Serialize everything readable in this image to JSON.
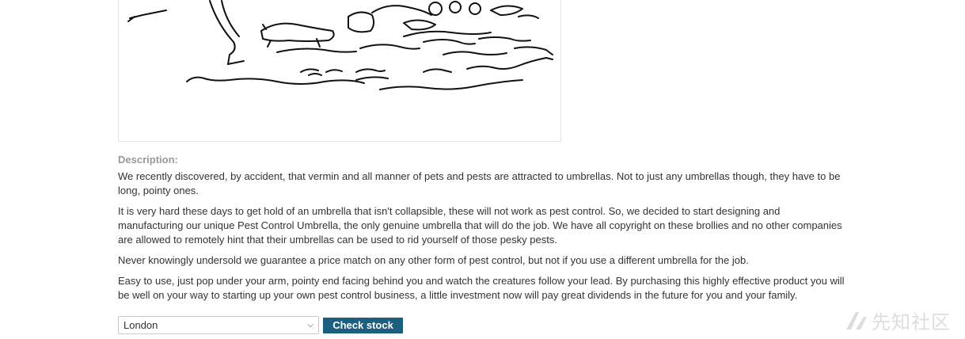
{
  "product": {
    "image_alt": "Pest Control Umbrella illustration",
    "description_label": "Description:",
    "description_paragraphs": [
      "We recently discovered, by accident, that vermin and all manner of pets and pests are attracted to umbrellas. Not to just any umbrellas though, they have to be long, pointy ones.",
      "It is very hard these days to get hold of an umbrella that isn't collapsible, these will not work as pest control. So, we decided to start designing and manufacturing our unique Pest Control Umbrella, the only genuine umbrella that will do the job. We have all copyright on these brollies and no other companies are allowed to remotely hint that their umbrellas can be used to rid yourself of those pesky pests.",
      "Never knowingly undersold we guarantee a price match on any other form of pest control, but not if you use a different umbrella for the job.",
      "Easy to use, just pop under your arm, pointy end facing behind you and watch the creatures follow your lead. By purchasing this highly effective product you will be well on your way to starting up your own pest control business, a little investment now will pay great dividends in the future for you and your family."
    ]
  },
  "stock_check": {
    "selected_store": "London",
    "button_label": "Check stock",
    "button_color": "#1c5f7f"
  },
  "watermark": {
    "text": "先知社区"
  }
}
